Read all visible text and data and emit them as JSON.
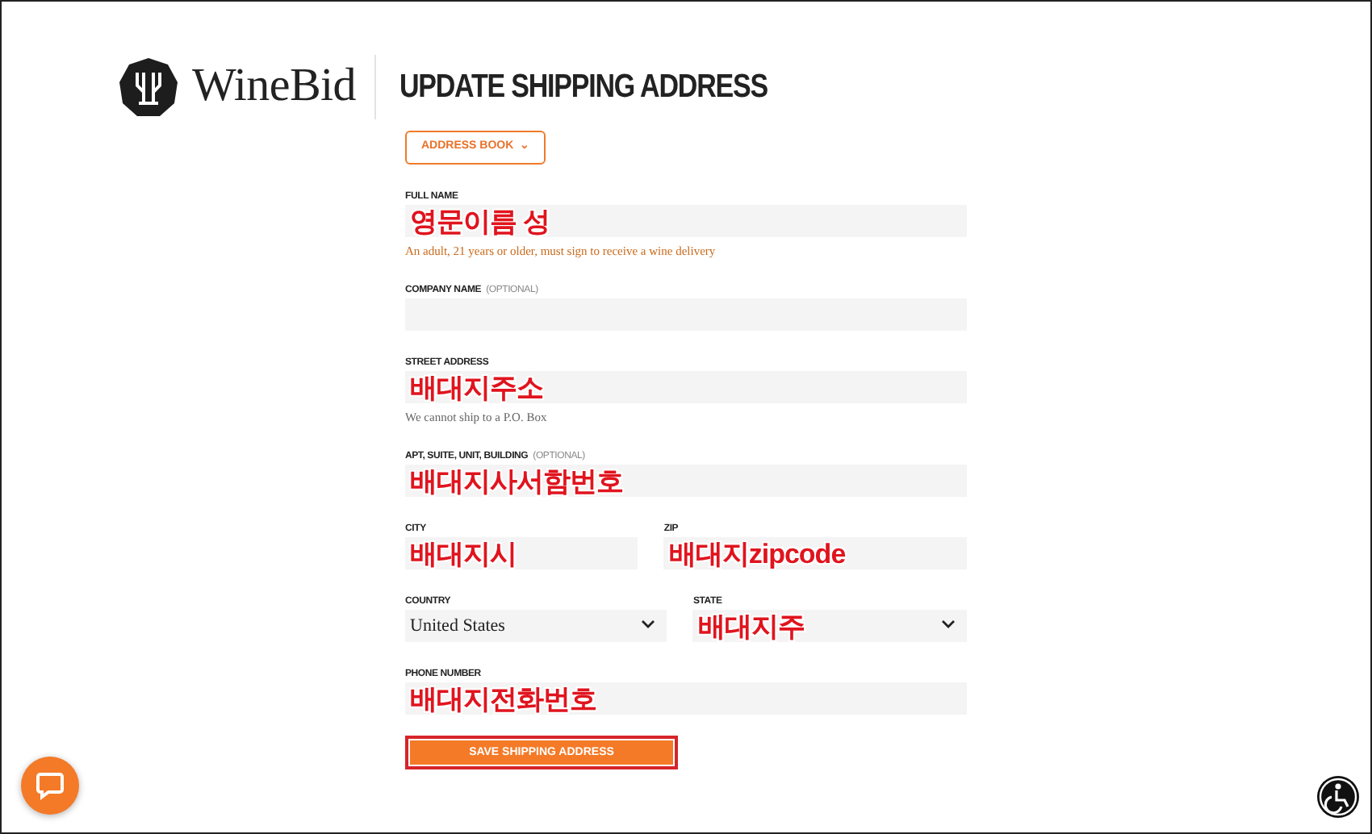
{
  "header": {
    "logo": "WineBid",
    "title": "UPDATE SHIPPING ADDRESS"
  },
  "address_book_button": {
    "label": "ADDRESS BOOK",
    "caret": "⌄"
  },
  "rows": [
    {
      "fields": [
        {
          "kind": "text",
          "label": "FULL NAME",
          "value": "영문이름 성",
          "hint": {
            "kind": "warning",
            "text": "An adult, 21 years or older, must sign to receive a wine delivery"
          }
        }
      ]
    },
    {
      "fields": [
        {
          "kind": "text",
          "label": "COMPANY NAME",
          "optional": "(OPTIONAL)"
        }
      ]
    },
    {
      "fields": [
        {
          "kind": "text",
          "label": "STREET ADDRESS",
          "value": "배대지주소",
          "hint": {
            "kind": "note",
            "text": "We cannot ship to a P.O. Box"
          }
        }
      ]
    },
    {
      "fields": [
        {
          "kind": "text",
          "label": "APT, SUITE, UNIT, BUILDING",
          "optional": "(OPTIONAL)",
          "value": "배대지사서함번호"
        }
      ]
    },
    {
      "fields": [
        {
          "kind": "text",
          "label": "CITY",
          "value": "배대지시"
        },
        {
          "kind": "text",
          "label": "ZIP",
          "value": "배대지zipcode"
        }
      ]
    },
    {
      "fields": [
        {
          "kind": "select",
          "label": "COUNTRY",
          "value": "United States",
          "plain": true
        },
        {
          "kind": "select",
          "label": "STATE",
          "value": "배대지주"
        }
      ]
    },
    {
      "fields": [
        {
          "kind": "text",
          "label": "PHONE NUMBER",
          "value": "배대지전화번호"
        }
      ]
    }
  ],
  "save_button": "SAVE SHIPPING ADDRESS"
}
